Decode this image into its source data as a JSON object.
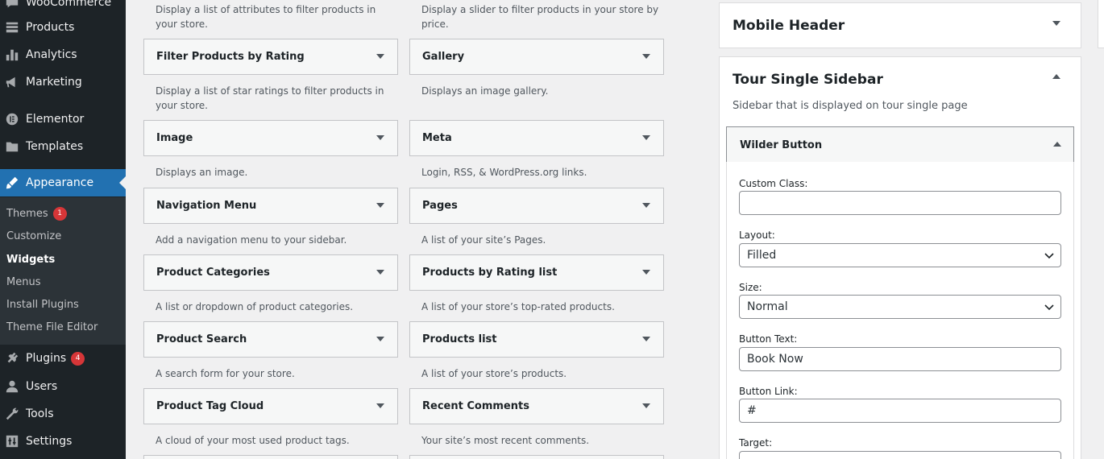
{
  "admin_menu": {
    "items": [
      {
        "label": "WooCommerce",
        "icon": "woocommerce-icon"
      },
      {
        "label": "Products",
        "icon": "products-icon"
      },
      {
        "label": "Analytics",
        "icon": "analytics-icon"
      },
      {
        "label": "Marketing",
        "icon": "megaphone-icon"
      },
      {
        "label": "Elementor",
        "icon": "elementor-icon"
      },
      {
        "label": "Templates",
        "icon": "folder-icon"
      },
      {
        "label": "Appearance",
        "icon": "paintbrush-icon"
      },
      {
        "label": "Plugins",
        "icon": "plug-icon",
        "badge": "4"
      },
      {
        "label": "Users",
        "icon": "users-icon"
      },
      {
        "label": "Tools",
        "icon": "wrench-icon"
      },
      {
        "label": "Settings",
        "icon": "settings-icon"
      }
    ],
    "appearance_submenu": [
      {
        "label": "Themes",
        "badge": "1"
      },
      {
        "label": "Customize"
      },
      {
        "label": "Widgets"
      },
      {
        "label": "Menus"
      },
      {
        "label": "Install Plugins"
      },
      {
        "label": "Theme File Editor"
      }
    ]
  },
  "widgets": {
    "top_descriptions": [
      "Display a list of attributes to filter products in your store.",
      "Display a slider to filter products in your store by price."
    ],
    "rows": [
      {
        "left": {
          "title": "Filter Products by Rating",
          "desc": "Display a list of star ratings to filter products in your store."
        },
        "right": {
          "title": "Gallery",
          "desc": "Displays an image gallery."
        }
      },
      {
        "left": {
          "title": "Image",
          "desc": "Displays an image."
        },
        "right": {
          "title": "Meta",
          "desc": "Login, RSS, & WordPress.org links."
        }
      },
      {
        "left": {
          "title": "Navigation Menu",
          "desc": "Add a navigation menu to your sidebar."
        },
        "right": {
          "title": "Pages",
          "desc": "A list of your site’s Pages."
        }
      },
      {
        "left": {
          "title": "Product Categories",
          "desc": "A list or dropdown of product categories."
        },
        "right": {
          "title": "Products by Rating list",
          "desc": "A list of your store’s top-rated products."
        }
      },
      {
        "left": {
          "title": "Product Search",
          "desc": "A search form for your store."
        },
        "right": {
          "title": "Products list",
          "desc": "A list of your store’s products."
        }
      },
      {
        "left": {
          "title": "Product Tag Cloud",
          "desc": "A cloud of your most used product tags."
        },
        "right": {
          "title": "Recent Comments",
          "desc": "Your site’s most recent comments."
        }
      }
    ]
  },
  "sidebars": {
    "mobile_header": {
      "title": "Mobile Header"
    },
    "tour_single": {
      "title": "Tour Single Sidebar",
      "description": "Sidebar that is displayed on tour single page",
      "widget": {
        "title": "Wilder Button",
        "fields": {
          "custom_class_label": "Custom Class:",
          "custom_class_value": "",
          "layout_label": "Layout:",
          "layout_value": "Filled",
          "size_label": "Size:",
          "size_value": "Normal",
          "button_text_label": "Button Text:",
          "button_text_value": "Book Now",
          "button_link_label": "Button Link:",
          "button_link_value": "#",
          "target_label": "Target:"
        }
      }
    }
  }
}
